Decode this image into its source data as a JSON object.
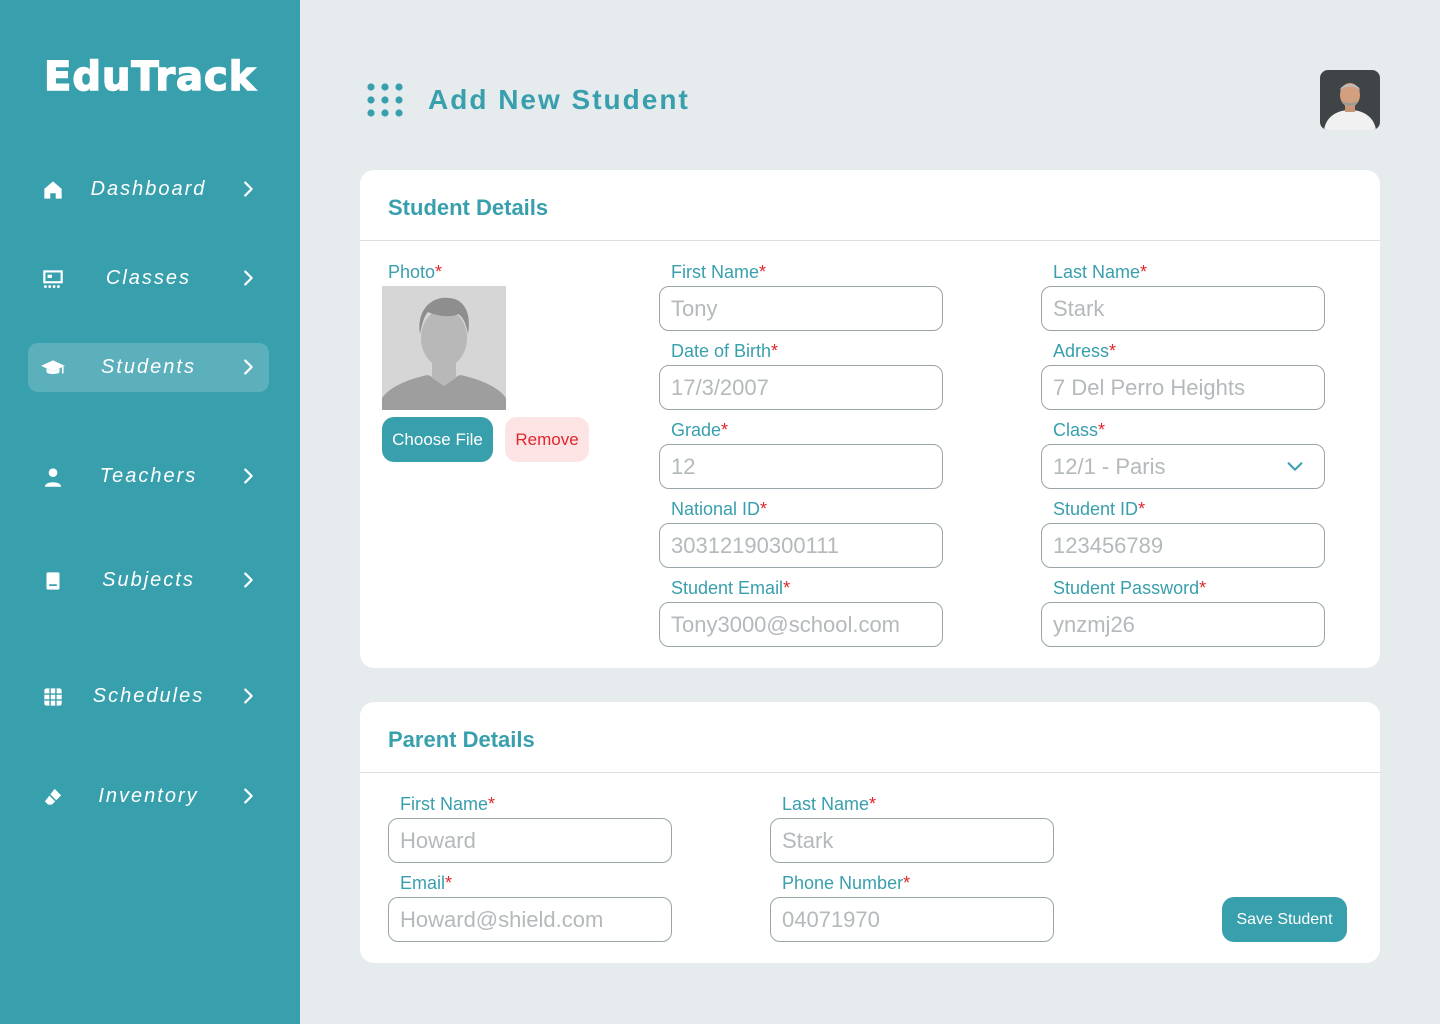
{
  "app": {
    "logo": "EduTrack"
  },
  "sidebar": {
    "items": [
      {
        "label": "Dashboard",
        "icon": "home-icon"
      },
      {
        "label": "Classes",
        "icon": "classroom-icon"
      },
      {
        "label": "Students",
        "icon": "graduation-cap-icon",
        "active": true
      },
      {
        "label": "Teachers",
        "icon": "person-icon"
      },
      {
        "label": "Subjects",
        "icon": "book-icon"
      },
      {
        "label": "Schedules",
        "icon": "calendar-grid-icon"
      },
      {
        "label": "Inventory",
        "icon": "eraser-icon"
      }
    ]
  },
  "header": {
    "title": "Add New Student"
  },
  "student": {
    "title": "Student Details",
    "photo_label": "Photo",
    "choose_file": "Choose File",
    "remove": "Remove",
    "fields": {
      "first_name": {
        "label": "First Name",
        "placeholder": "Tony"
      },
      "last_name": {
        "label": "Last Name",
        "placeholder": "Stark"
      },
      "dob": {
        "label": "Date of Birth",
        "placeholder": "17/3/2007"
      },
      "address": {
        "label": "Adress",
        "placeholder": "7 Del Perro Heights"
      },
      "grade": {
        "label": "Grade",
        "placeholder": "12"
      },
      "class": {
        "label": "Class",
        "value": "12/1 - Paris"
      },
      "national_id": {
        "label": "National ID",
        "placeholder": "30312190300111"
      },
      "student_id": {
        "label": "Student ID",
        "placeholder": "123456789"
      },
      "email": {
        "label": "Student Email",
        "placeholder": "Tony3000@school.com"
      },
      "password": {
        "label": "Student Password",
        "placeholder": "ynzmj26"
      }
    }
  },
  "parent": {
    "title": "Parent Details",
    "fields": {
      "first_name": {
        "label": "First Name",
        "placeholder": "Howard"
      },
      "last_name": {
        "label": "Last Name",
        "placeholder": "Stark"
      },
      "email": {
        "label": "Email",
        "placeholder": "Howard@shield.com"
      },
      "phone": {
        "label": "Phone Number",
        "placeholder": "04071970"
      }
    },
    "save": "Save Student"
  },
  "required_mark": "*",
  "colors": {
    "accent": "#389fad",
    "required": "#e0262d",
    "background": "#e6ebee"
  }
}
